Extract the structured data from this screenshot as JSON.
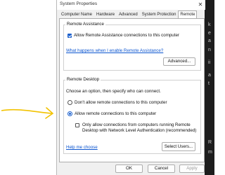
{
  "window": {
    "title": "System Properties"
  },
  "tabs": [
    {
      "label": "Computer Name"
    },
    {
      "label": "Hardware"
    },
    {
      "label": "Advanced"
    },
    {
      "label": "System Protection"
    },
    {
      "label": "Remote"
    }
  ],
  "active_tab": "Remote",
  "remote_assistance": {
    "group_label": "Remote Assistance",
    "allow_label": "Allow Remote Assistance connections to this computer",
    "allow_checked": true,
    "help_link": "What happens when I enable Remote Assistance?",
    "advanced_button": "Advanced..."
  },
  "remote_desktop": {
    "group_label": "Remote Desktop",
    "instruction": "Choose an option, then specify who can connect.",
    "option_dont_allow": "Don't allow remote connections to this computer",
    "option_allow": "Allow remote connections to this computer",
    "selected_option": "allow",
    "nla_label_line1": "Only allow connections from computers running Remote",
    "nla_label_line2": "Desktop with Network Level Authentication (recommended)",
    "nla_checked": false,
    "help_link": "Help me choose",
    "select_users_button": "Select Users..."
  },
  "footer": {
    "ok": "OK",
    "cancel": "Cancel",
    "apply": "Apply"
  },
  "background": {
    "right_chars": [
      "k",
      "e",
      "a",
      "n",
      "ii",
      "a",
      "t",
      "R",
      "m"
    ]
  },
  "colors": {
    "accent": "#1a5fcc",
    "link": "#0b55d0",
    "arrow": "#f2c200"
  }
}
